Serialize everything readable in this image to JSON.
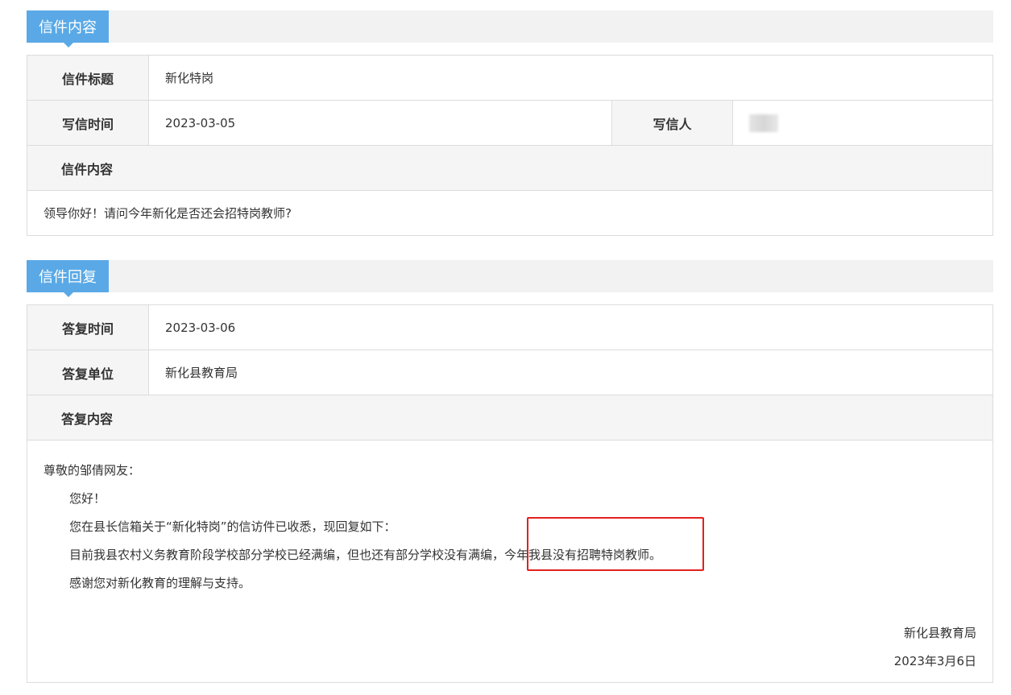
{
  "letter": {
    "section_title": "信件内容",
    "title_label": "信件标题",
    "title_value": "新化特岗",
    "time_label": "写信时间",
    "time_value": "2023-03-05",
    "writer_label": "写信人",
    "content_label": "信件内容",
    "content_value": "领导你好！请问今年新化是否还会招特岗教师?"
  },
  "reply": {
    "section_title": "信件回复",
    "time_label": "答复时间",
    "time_value": "2023-03-06",
    "unit_label": "答复单位",
    "unit_value": "新化县教育局",
    "content_label": "答复内容",
    "greeting": "尊敬的邹倩网友：",
    "hello": "您好！",
    "line1": "您在县长信箱关于“新化特岗”的信访件已收悉，现回复如下：",
    "line2_a": "目前我县农村义务教育阶段学校部分学校已经满编，但也还有部分学校没有满编，",
    "line2_b": "今年我县没有招聘特岗教师。",
    "line3": "感谢您对新化教育的理解与支持。",
    "sign_org": "新化县教育局",
    "sign_date": "2023年3月6日"
  },
  "colors": {
    "tab": "#5aa9e6",
    "highlight": "#e32020"
  }
}
